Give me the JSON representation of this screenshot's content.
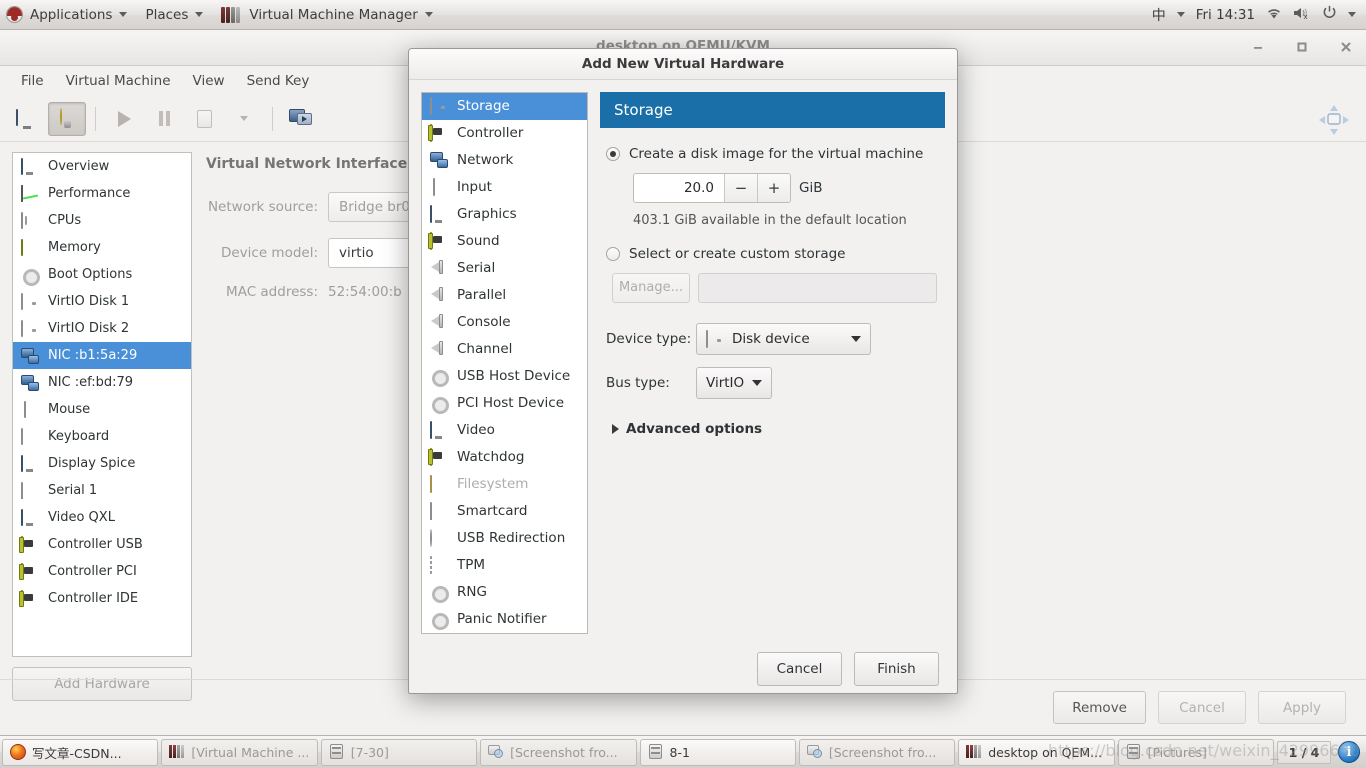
{
  "panel": {
    "applications": "Applications",
    "places": "Places",
    "app_title": "Virtual Machine Manager",
    "ime": "中",
    "clock": "Fri 14:31"
  },
  "main_window": {
    "title": "desktop on QEMU/KVM",
    "menus": [
      "File",
      "Virtual Machine",
      "View",
      "Send Key"
    ],
    "toolbar": [
      {
        "name": "show-console-button",
        "icon": "monitor-icon"
      },
      {
        "name": "show-details-button",
        "icon": "lightbulb-icon"
      },
      {
        "name": "run-button",
        "icon": "play-icon"
      },
      {
        "name": "pause-button",
        "icon": "pause-icon"
      },
      {
        "name": "shutdown-button",
        "icon": "stop-icon"
      },
      {
        "name": "shutdown-menu-button",
        "icon": "chevron-down-icon"
      },
      {
        "name": "fullscreen-button",
        "icon": "screens-icon"
      }
    ],
    "hardware_list": [
      {
        "label": "Overview",
        "icon": "monitor-icon",
        "selected": false
      },
      {
        "label": "Performance",
        "icon": "performance-icon",
        "selected": false
      },
      {
        "label": "CPUs",
        "icon": "cpu-icon",
        "selected": false
      },
      {
        "label": "Memory",
        "icon": "memory-icon",
        "selected": false
      },
      {
        "label": "Boot Options",
        "icon": "gear-icon",
        "selected": false
      },
      {
        "label": "VirtIO Disk 1",
        "icon": "disk-icon",
        "selected": false
      },
      {
        "label": "VirtIO Disk 2",
        "icon": "disk-icon",
        "selected": false
      },
      {
        "label": "NIC :b1:5a:29",
        "icon": "network-icon",
        "selected": true
      },
      {
        "label": "NIC :ef:bd:79",
        "icon": "network-icon",
        "selected": false
      },
      {
        "label": "Mouse",
        "icon": "mouse-icon",
        "selected": false
      },
      {
        "label": "Keyboard",
        "icon": "keyboard-icon",
        "selected": false
      },
      {
        "label": "Display Spice",
        "icon": "monitor-icon",
        "selected": false
      },
      {
        "label": "Serial 1",
        "icon": "smartcard-icon",
        "selected": false
      },
      {
        "label": "Video QXL",
        "icon": "monitor-icon",
        "selected": false
      },
      {
        "label": "Controller USB",
        "icon": "card-icon",
        "selected": false
      },
      {
        "label": "Controller PCI",
        "icon": "card-icon",
        "selected": false
      },
      {
        "label": "Controller IDE",
        "icon": "card-icon",
        "selected": false
      }
    ],
    "add_hardware_label": "Add Hardware",
    "detail": {
      "title": "Virtual Network Interface",
      "fields": [
        {
          "label": "Network source:",
          "value": "Bridge br0",
          "type": "combo"
        },
        {
          "label": "Device model:",
          "value": "virtio",
          "type": "combo-white"
        },
        {
          "label": "MAC address:",
          "value": "52:54:00:b",
          "type": "text"
        }
      ]
    },
    "footer_buttons": [
      {
        "label": "Remove",
        "disabled": false
      },
      {
        "label": "Cancel",
        "disabled": true
      },
      {
        "label": "Apply",
        "disabled": true
      }
    ]
  },
  "dialog": {
    "title": "Add New Virtual Hardware",
    "device_list": [
      {
        "label": "Storage",
        "icon": "storage-icon",
        "selected": true,
        "disabled": false
      },
      {
        "label": "Controller",
        "icon": "card-icon",
        "selected": false,
        "disabled": false
      },
      {
        "label": "Network",
        "icon": "network-icon",
        "selected": false,
        "disabled": false
      },
      {
        "label": "Input",
        "icon": "mouse-icon",
        "selected": false,
        "disabled": false
      },
      {
        "label": "Graphics",
        "icon": "monitor-icon",
        "selected": false,
        "disabled": false
      },
      {
        "label": "Sound",
        "icon": "card-icon",
        "selected": false,
        "disabled": false
      },
      {
        "label": "Serial",
        "icon": "speaker-icon",
        "selected": false,
        "disabled": false
      },
      {
        "label": "Parallel",
        "icon": "speaker-icon",
        "selected": false,
        "disabled": false
      },
      {
        "label": "Console",
        "icon": "speaker-icon",
        "selected": false,
        "disabled": false
      },
      {
        "label": "Channel",
        "icon": "speaker-icon",
        "selected": false,
        "disabled": false
      },
      {
        "label": "USB Host Device",
        "icon": "gear-icon",
        "selected": false,
        "disabled": false
      },
      {
        "label": "PCI Host Device",
        "icon": "gear-icon",
        "selected": false,
        "disabled": false
      },
      {
        "label": "Video",
        "icon": "monitor-icon",
        "selected": false,
        "disabled": false
      },
      {
        "label": "Watchdog",
        "icon": "card-icon",
        "selected": false,
        "disabled": false
      },
      {
        "label": "Filesystem",
        "icon": "folder-icon",
        "selected": false,
        "disabled": true
      },
      {
        "label": "Smartcard",
        "icon": "smartcard-icon",
        "selected": false,
        "disabled": false
      },
      {
        "label": "USB Redirection",
        "icon": "usb-icon",
        "selected": false,
        "disabled": false
      },
      {
        "label": "TPM",
        "icon": "tpm-icon",
        "selected": false,
        "disabled": false
      },
      {
        "label": "RNG",
        "icon": "gear-icon",
        "selected": false,
        "disabled": false
      },
      {
        "label": "Panic Notifier",
        "icon": "gear-icon",
        "selected": false,
        "disabled": false
      }
    ],
    "section_title": "Storage",
    "create_disk_label": "Create a disk image for the virtual machine",
    "create_disk_selected": true,
    "disk_size": "20.0",
    "disk_size_unit": "GiB",
    "spin_minus": "−",
    "spin_plus": "+",
    "available_note": "403.1 GiB available in the default location",
    "custom_storage_label": "Select or create custom storage",
    "custom_storage_selected": false,
    "manage_label": "Manage...",
    "path_value": "",
    "device_type_label": "Device type:",
    "device_type_value": "Disk device",
    "bus_type_label": "Bus type:",
    "bus_type_value": "VirtIO",
    "advanced_options_label": "Advanced options",
    "cancel_label": "Cancel",
    "finish_label": "Finish"
  },
  "taskbar": {
    "items": [
      {
        "label": "写文章-CSDN...",
        "icon": "firefox-icon",
        "active": true
      },
      {
        "label": "[Virtual Machine ...",
        "icon": "vmm-icon",
        "active": false
      },
      {
        "label": "[7-30]",
        "icon": "files-icon",
        "active": false
      },
      {
        "label": "[Screenshot fro...",
        "icon": "screenshot-icon",
        "active": false
      },
      {
        "label": "8-1",
        "icon": "files-icon",
        "active": true
      },
      {
        "label": "[Screenshot fro...",
        "icon": "screenshot-icon",
        "active": false
      },
      {
        "label": "desktop on QEM...",
        "icon": "vmm-icon",
        "active": true
      },
      {
        "label": "[Pictures]",
        "icon": "files-icon",
        "active": false
      }
    ],
    "pager": "1 / 4"
  },
  "watermark": "https://blog.csdn.net/weixin_42996650"
}
